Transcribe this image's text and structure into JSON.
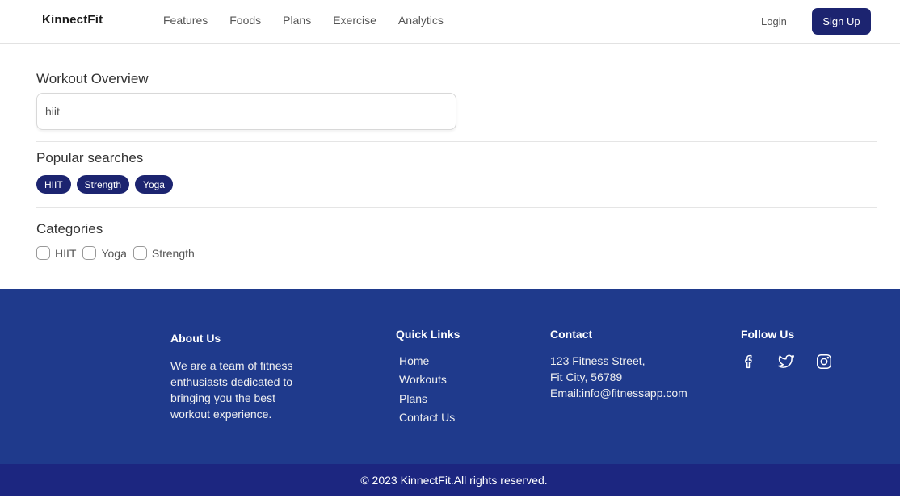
{
  "navbar": {
    "brand": "KinnectFit",
    "links": [
      "Features",
      "Foods",
      "Plans",
      "Exercise",
      "Analytics"
    ],
    "login_label": "Login",
    "signup_label": "Sign Up"
  },
  "workout": {
    "title": "Workout Overview",
    "search_value": "hiit"
  },
  "popular": {
    "title": "Popular searches",
    "chips": [
      "HIIT",
      "Strength",
      "Yoga"
    ]
  },
  "categories": {
    "title": "Categories",
    "items": [
      "HIIT",
      "Yoga",
      "Strength"
    ]
  },
  "footer": {
    "about": {
      "title": "About Us",
      "text": "We are a team of fitness enthusiasts dedicated to bringing you the best workout experience."
    },
    "quick_links": {
      "title": "Quick Links",
      "items": [
        "Home",
        "Workouts",
        "Plans",
        "Contact Us"
      ]
    },
    "contact": {
      "title": "Contact",
      "lines": [
        "123 Fitness Street,",
        "Fit City, 56789",
        "Email:info@fitnessapp.com"
      ]
    },
    "follow": {
      "title": "Follow Us",
      "icons": [
        "facebook-icon",
        "twitter-icon",
        "instagram-icon"
      ]
    },
    "copyright": "© 2023 KinnectFit.All rights reserved."
  },
  "colors": {
    "primary": "#1c2470",
    "footer_bg": "#1f3a8c",
    "copyright_bg": "#1c2680"
  }
}
